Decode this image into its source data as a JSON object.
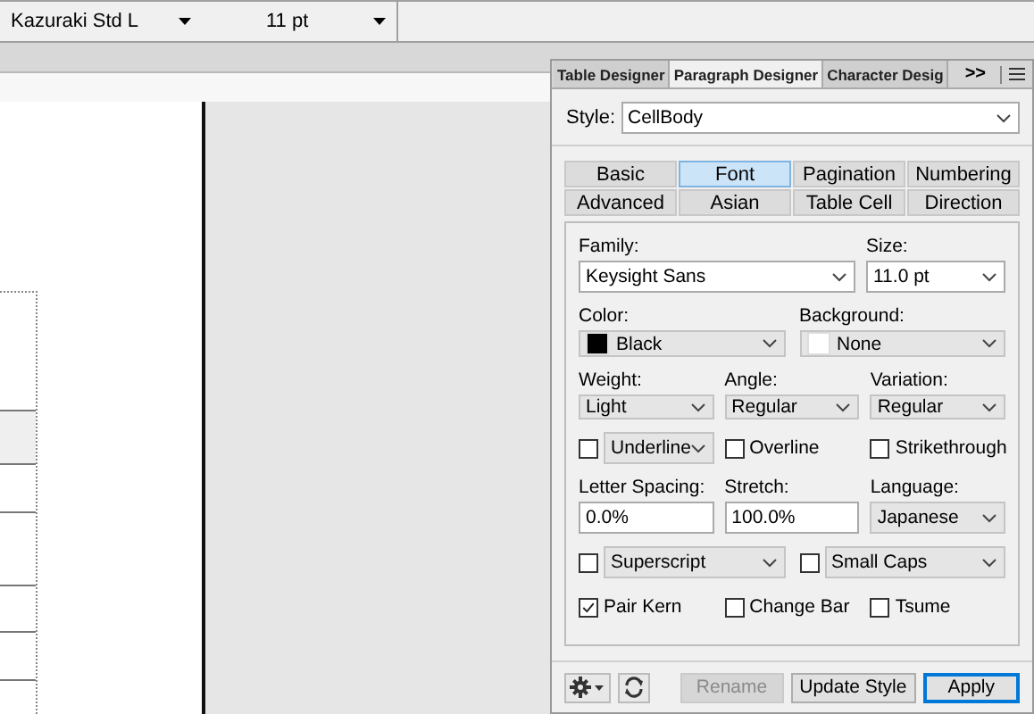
{
  "toolbar": {
    "font": "Kazuraki Std L",
    "size": "11 pt"
  },
  "panel": {
    "tabs": [
      {
        "label": "Table Designer",
        "selected": false
      },
      {
        "label": "Paragraph Designer",
        "selected": true
      },
      {
        "label": "Character Desig",
        "selected": false
      }
    ],
    "overflow": ">>",
    "style": {
      "label": "Style:",
      "value": "CellBody"
    },
    "sections": [
      [
        {
          "label": "Basic",
          "selected": false
        },
        {
          "label": "Font",
          "selected": true
        },
        {
          "label": "Pagination",
          "selected": false
        },
        {
          "label": "Numbering",
          "selected": false
        }
      ],
      [
        {
          "label": "Advanced",
          "selected": false
        },
        {
          "label": "Asian",
          "selected": false
        },
        {
          "label": "Table Cell",
          "selected": false
        },
        {
          "label": "Direction",
          "selected": false
        }
      ]
    ],
    "rows": [
      [
        {
          "kind": "editable",
          "label": "Family:",
          "value": "Keysight Sans"
        },
        {
          "kind": "editable",
          "label": "Size:",
          "value": "11.0 pt"
        }
      ],
      [
        {
          "kind": "color",
          "label": "Color:",
          "value": "Black",
          "color": "#000000"
        },
        {
          "kind": "color",
          "label": "Background:",
          "value": "None",
          "color": "#ffffff"
        }
      ],
      [
        {
          "kind": "select",
          "label": "Weight:",
          "value": "Light"
        },
        {
          "kind": "select",
          "label": "Angle:",
          "value": "Regular"
        },
        {
          "kind": "select",
          "label": "Variation:",
          "value": "Regular"
        }
      ],
      [
        {
          "kind": "check-select",
          "value": "Underline",
          "checked": false
        },
        {
          "kind": "check",
          "value": "Overline",
          "checked": false
        },
        {
          "kind": "check",
          "value": "Strikethrough",
          "checked": false
        }
      ],
      [
        {
          "kind": "input",
          "label": "Letter Spacing:",
          "value": "0.0%"
        },
        {
          "kind": "input",
          "label": "Stretch:",
          "value": "100.0%"
        },
        {
          "kind": "select",
          "label": "Language:",
          "value": "Japanese"
        }
      ],
      [
        {
          "kind": "check-select",
          "value": "Superscript",
          "checked": false
        },
        {
          "kind": "check-select",
          "value": "Small Caps",
          "checked": false
        }
      ],
      [
        {
          "kind": "check",
          "value": "Pair Kern",
          "checked": true
        },
        {
          "kind": "check",
          "value": "Change Bar",
          "checked": false
        },
        {
          "kind": "check",
          "value": "Tsume",
          "checked": false
        }
      ]
    ],
    "buttons": [
      {
        "label": "Rename",
        "disabled": true,
        "default": false
      },
      {
        "label": "Update Style",
        "disabled": false,
        "default": false
      },
      {
        "label": "Apply",
        "disabled": false,
        "default": true
      }
    ]
  }
}
